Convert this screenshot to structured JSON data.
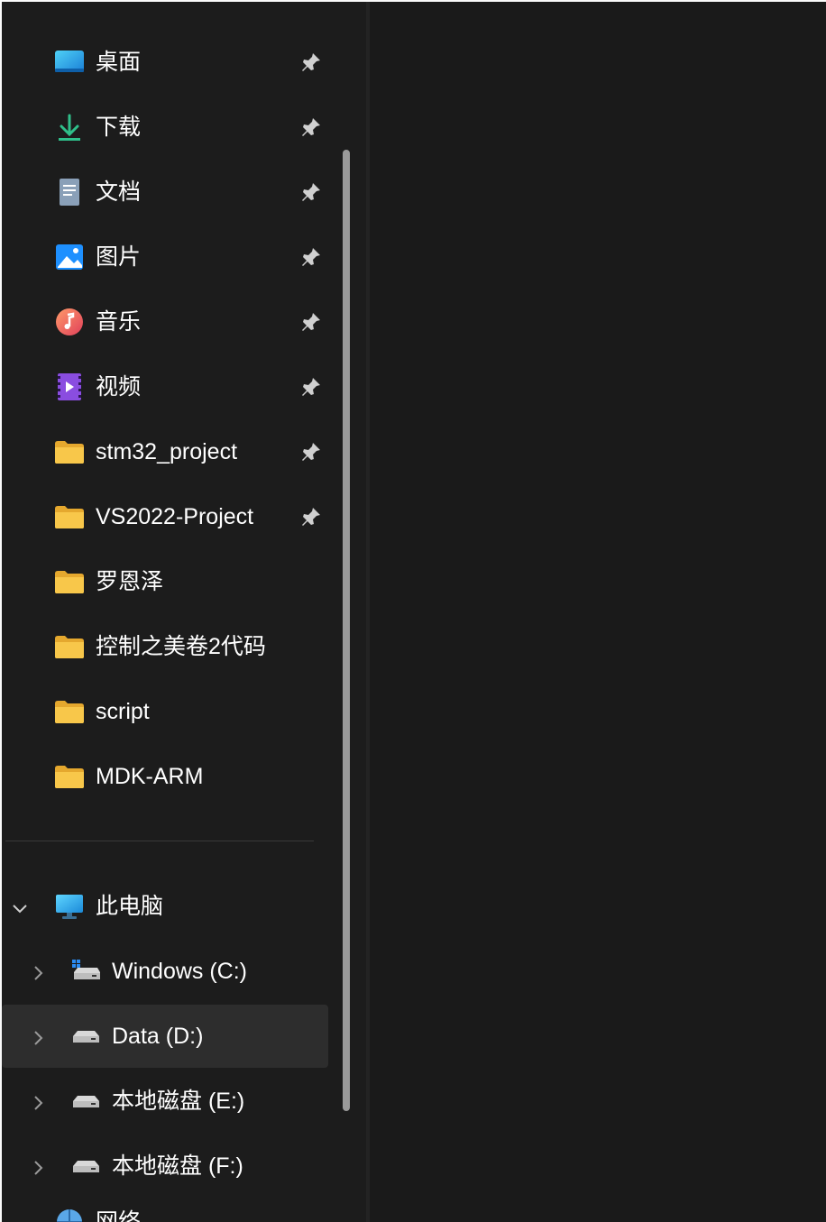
{
  "quick_access": {
    "items": [
      {
        "label": "桌面",
        "icon": "desktop-icon",
        "pinned": true
      },
      {
        "label": "下载",
        "icon": "download-icon",
        "pinned": true
      },
      {
        "label": "文档",
        "icon": "document-icon",
        "pinned": true
      },
      {
        "label": "图片",
        "icon": "pictures-icon",
        "pinned": true
      },
      {
        "label": "音乐",
        "icon": "music-icon",
        "pinned": true
      },
      {
        "label": "视频",
        "icon": "video-icon",
        "pinned": true
      },
      {
        "label": "stm32_project",
        "icon": "folder-icon",
        "pinned": true
      },
      {
        "label": "VS2022-Project",
        "icon": "folder-icon",
        "pinned": true
      },
      {
        "label": "罗恩泽",
        "icon": "folder-icon",
        "pinned": false
      },
      {
        "label": "控制之美卷2代码",
        "icon": "folder-icon",
        "pinned": false
      },
      {
        "label": "script",
        "icon": "folder-icon",
        "pinned": false
      },
      {
        "label": "MDK-ARM",
        "icon": "folder-icon",
        "pinned": false
      }
    ]
  },
  "this_pc": {
    "label": "此电脑",
    "expanded": true,
    "drives": [
      {
        "label": "Windows (C:)",
        "icon": "system-drive-icon",
        "selected": false
      },
      {
        "label": "Data (D:)",
        "icon": "drive-icon",
        "selected": true
      },
      {
        "label": "本地磁盘 (E:)",
        "icon": "drive-icon",
        "selected": false
      },
      {
        "label": "本地磁盘 (F:)",
        "icon": "drive-icon",
        "selected": false
      }
    ]
  },
  "network": {
    "label": "网络"
  },
  "colors": {
    "background": "#1c1c1c",
    "text": "#ffffff",
    "selected_row": "#2d2d2d",
    "folder": "#f8c74a",
    "scrollbar": "#9a9a9a"
  }
}
